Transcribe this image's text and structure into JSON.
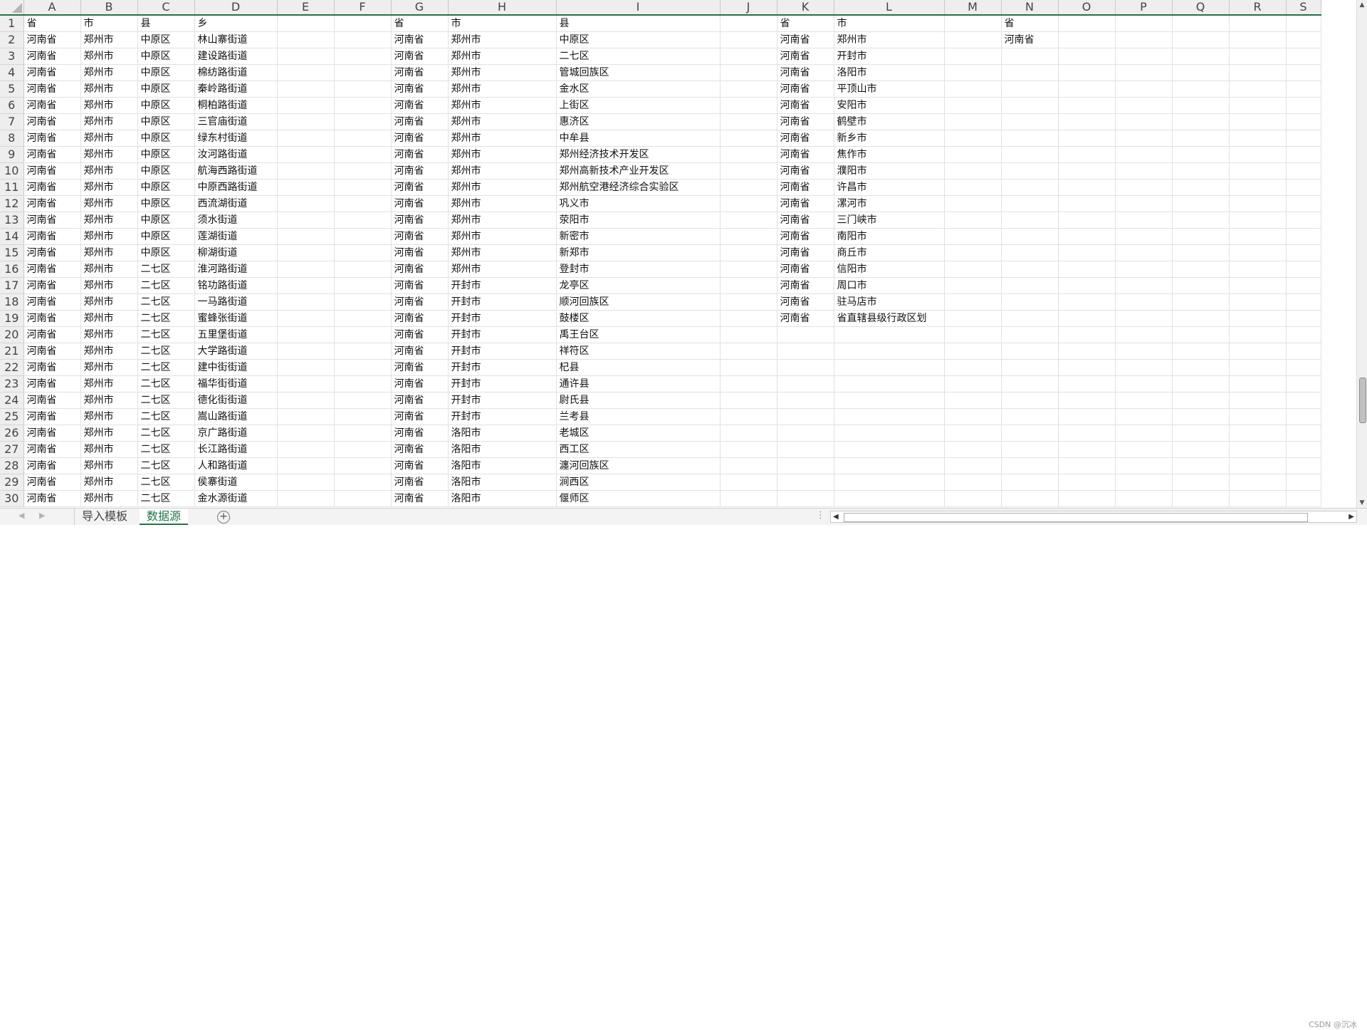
{
  "columns": [
    "A",
    "B",
    "C",
    "D",
    "E",
    "F",
    "G",
    "H",
    "I",
    "J",
    "K",
    "L",
    "M",
    "N",
    "O",
    "P",
    "Q",
    "R",
    "S"
  ],
  "rows": [
    [
      "省",
      "市",
      "县",
      "乡",
      "",
      "",
      "省",
      "市",
      "县",
      "",
      "省",
      "市",
      "",
      "省",
      "",
      "",
      "",
      "",
      ""
    ],
    [
      "河南省",
      "郑州市",
      "中原区",
      "林山寨街道",
      "",
      "",
      "河南省",
      "郑州市",
      "中原区",
      "",
      "河南省",
      "郑州市",
      "",
      "河南省",
      "",
      "",
      "",
      "",
      ""
    ],
    [
      "河南省",
      "郑州市",
      "中原区",
      "建设路街道",
      "",
      "",
      "河南省",
      "郑州市",
      "二七区",
      "",
      "河南省",
      "开封市",
      "",
      "",
      "",
      "",
      "",
      "",
      ""
    ],
    [
      "河南省",
      "郑州市",
      "中原区",
      "棉纺路街道",
      "",
      "",
      "河南省",
      "郑州市",
      "管城回族区",
      "",
      "河南省",
      "洛阳市",
      "",
      "",
      "",
      "",
      "",
      "",
      ""
    ],
    [
      "河南省",
      "郑州市",
      "中原区",
      "秦岭路街道",
      "",
      "",
      "河南省",
      "郑州市",
      "金水区",
      "",
      "河南省",
      "平顶山市",
      "",
      "",
      "",
      "",
      "",
      "",
      ""
    ],
    [
      "河南省",
      "郑州市",
      "中原区",
      "桐柏路街道",
      "",
      "",
      "河南省",
      "郑州市",
      "上街区",
      "",
      "河南省",
      "安阳市",
      "",
      "",
      "",
      "",
      "",
      "",
      ""
    ],
    [
      "河南省",
      "郑州市",
      "中原区",
      "三官庙街道",
      "",
      "",
      "河南省",
      "郑州市",
      "惠济区",
      "",
      "河南省",
      "鹤壁市",
      "",
      "",
      "",
      "",
      "",
      "",
      ""
    ],
    [
      "河南省",
      "郑州市",
      "中原区",
      "绿东村街道",
      "",
      "",
      "河南省",
      "郑州市",
      "中牟县",
      "",
      "河南省",
      "新乡市",
      "",
      "",
      "",
      "",
      "",
      "",
      ""
    ],
    [
      "河南省",
      "郑州市",
      "中原区",
      "汝河路街道",
      "",
      "",
      "河南省",
      "郑州市",
      "郑州经济技术开发区",
      "",
      "河南省",
      "焦作市",
      "",
      "",
      "",
      "",
      "",
      "",
      ""
    ],
    [
      "河南省",
      "郑州市",
      "中原区",
      "航海西路街道",
      "",
      "",
      "河南省",
      "郑州市",
      "郑州高新技术产业开发区",
      "",
      "河南省",
      "濮阳市",
      "",
      "",
      "",
      "",
      "",
      "",
      ""
    ],
    [
      "河南省",
      "郑州市",
      "中原区",
      "中原西路街道",
      "",
      "",
      "河南省",
      "郑州市",
      "郑州航空港经济综合实验区",
      "",
      "河南省",
      "许昌市",
      "",
      "",
      "",
      "",
      "",
      "",
      ""
    ],
    [
      "河南省",
      "郑州市",
      "中原区",
      "西流湖街道",
      "",
      "",
      "河南省",
      "郑州市",
      "巩义市",
      "",
      "河南省",
      "漯河市",
      "",
      "",
      "",
      "",
      "",
      "",
      ""
    ],
    [
      "河南省",
      "郑州市",
      "中原区",
      "须水街道",
      "",
      "",
      "河南省",
      "郑州市",
      "荥阳市",
      "",
      "河南省",
      "三门峡市",
      "",
      "",
      "",
      "",
      "",
      "",
      ""
    ],
    [
      "河南省",
      "郑州市",
      "中原区",
      "莲湖街道",
      "",
      "",
      "河南省",
      "郑州市",
      "新密市",
      "",
      "河南省",
      "南阳市",
      "",
      "",
      "",
      "",
      "",
      "",
      ""
    ],
    [
      "河南省",
      "郑州市",
      "中原区",
      "柳湖街道",
      "",
      "",
      "河南省",
      "郑州市",
      "新郑市",
      "",
      "河南省",
      "商丘市",
      "",
      "",
      "",
      "",
      "",
      "",
      ""
    ],
    [
      "河南省",
      "郑州市",
      "二七区",
      "淮河路街道",
      "",
      "",
      "河南省",
      "郑州市",
      "登封市",
      "",
      "河南省",
      "信阳市",
      "",
      "",
      "",
      "",
      "",
      "",
      ""
    ],
    [
      "河南省",
      "郑州市",
      "二七区",
      "铭功路街道",
      "",
      "",
      "河南省",
      "开封市",
      "龙亭区",
      "",
      "河南省",
      "周口市",
      "",
      "",
      "",
      "",
      "",
      "",
      ""
    ],
    [
      "河南省",
      "郑州市",
      "二七区",
      "一马路街道",
      "",
      "",
      "河南省",
      "开封市",
      "顺河回族区",
      "",
      "河南省",
      "驻马店市",
      "",
      "",
      "",
      "",
      "",
      "",
      ""
    ],
    [
      "河南省",
      "郑州市",
      "二七区",
      "蜜蜂张街道",
      "",
      "",
      "河南省",
      "开封市",
      "鼓楼区",
      "",
      "河南省",
      "省直辖县级行政区划",
      "",
      "",
      "",
      "",
      "",
      "",
      ""
    ],
    [
      "河南省",
      "郑州市",
      "二七区",
      "五里堡街道",
      "",
      "",
      "河南省",
      "开封市",
      "禹王台区",
      "",
      "",
      "",
      "",
      "",
      "",
      "",
      "",
      "",
      ""
    ],
    [
      "河南省",
      "郑州市",
      "二七区",
      "大学路街道",
      "",
      "",
      "河南省",
      "开封市",
      "祥符区",
      "",
      "",
      "",
      "",
      "",
      "",
      "",
      "",
      "",
      ""
    ],
    [
      "河南省",
      "郑州市",
      "二七区",
      "建中街街道",
      "",
      "",
      "河南省",
      "开封市",
      "杞县",
      "",
      "",
      "",
      "",
      "",
      "",
      "",
      "",
      "",
      ""
    ],
    [
      "河南省",
      "郑州市",
      "二七区",
      "福华街街道",
      "",
      "",
      "河南省",
      "开封市",
      "通许县",
      "",
      "",
      "",
      "",
      "",
      "",
      "",
      "",
      "",
      ""
    ],
    [
      "河南省",
      "郑州市",
      "二七区",
      "德化街街道",
      "",
      "",
      "河南省",
      "开封市",
      "尉氏县",
      "",
      "",
      "",
      "",
      "",
      "",
      "",
      "",
      "",
      ""
    ],
    [
      "河南省",
      "郑州市",
      "二七区",
      "嵩山路街道",
      "",
      "",
      "河南省",
      "开封市",
      "兰考县",
      "",
      "",
      "",
      "",
      "",
      "",
      "",
      "",
      "",
      ""
    ],
    [
      "河南省",
      "郑州市",
      "二七区",
      "京广路街道",
      "",
      "",
      "河南省",
      "洛阳市",
      "老城区",
      "",
      "",
      "",
      "",
      "",
      "",
      "",
      "",
      "",
      ""
    ],
    [
      "河南省",
      "郑州市",
      "二七区",
      "长江路街道",
      "",
      "",
      "河南省",
      "洛阳市",
      "西工区",
      "",
      "",
      "",
      "",
      "",
      "",
      "",
      "",
      "",
      ""
    ],
    [
      "河南省",
      "郑州市",
      "二七区",
      "人和路街道",
      "",
      "",
      "河南省",
      "洛阳市",
      "瀍河回族区",
      "",
      "",
      "",
      "",
      "",
      "",
      "",
      "",
      "",
      ""
    ],
    [
      "河南省",
      "郑州市",
      "二七区",
      "侯寨街道",
      "",
      "",
      "河南省",
      "洛阳市",
      "涧西区",
      "",
      "",
      "",
      "",
      "",
      "",
      "",
      "",
      "",
      ""
    ],
    [
      "河南省",
      "郑州市",
      "二七区",
      "金水源街道",
      "",
      "",
      "河南省",
      "洛阳市",
      "偃师区",
      "",
      "",
      "",
      "",
      "",
      "",
      "",
      "",
      "",
      ""
    ]
  ],
  "sheet_tabs": [
    {
      "label": "导入模板",
      "active": false
    },
    {
      "label": "数据源",
      "active": true
    }
  ],
  "ui": {
    "nav_left": "◀",
    "nav_right": "▶",
    "add_sheet": "+",
    "dots": "⋮",
    "scroll_left": "◀",
    "scroll_right": "▶",
    "scroll_up": "▲",
    "scroll_down": "▼",
    "watermark": "CSDN @沉冰"
  },
  "colors": {
    "accent": "#217346",
    "header_bg": "#eeeeee",
    "gridline": "#e1e1e1"
  },
  "icons": [
    "add-sheet-icon",
    "select-all-icon",
    "more-options-icon"
  ]
}
